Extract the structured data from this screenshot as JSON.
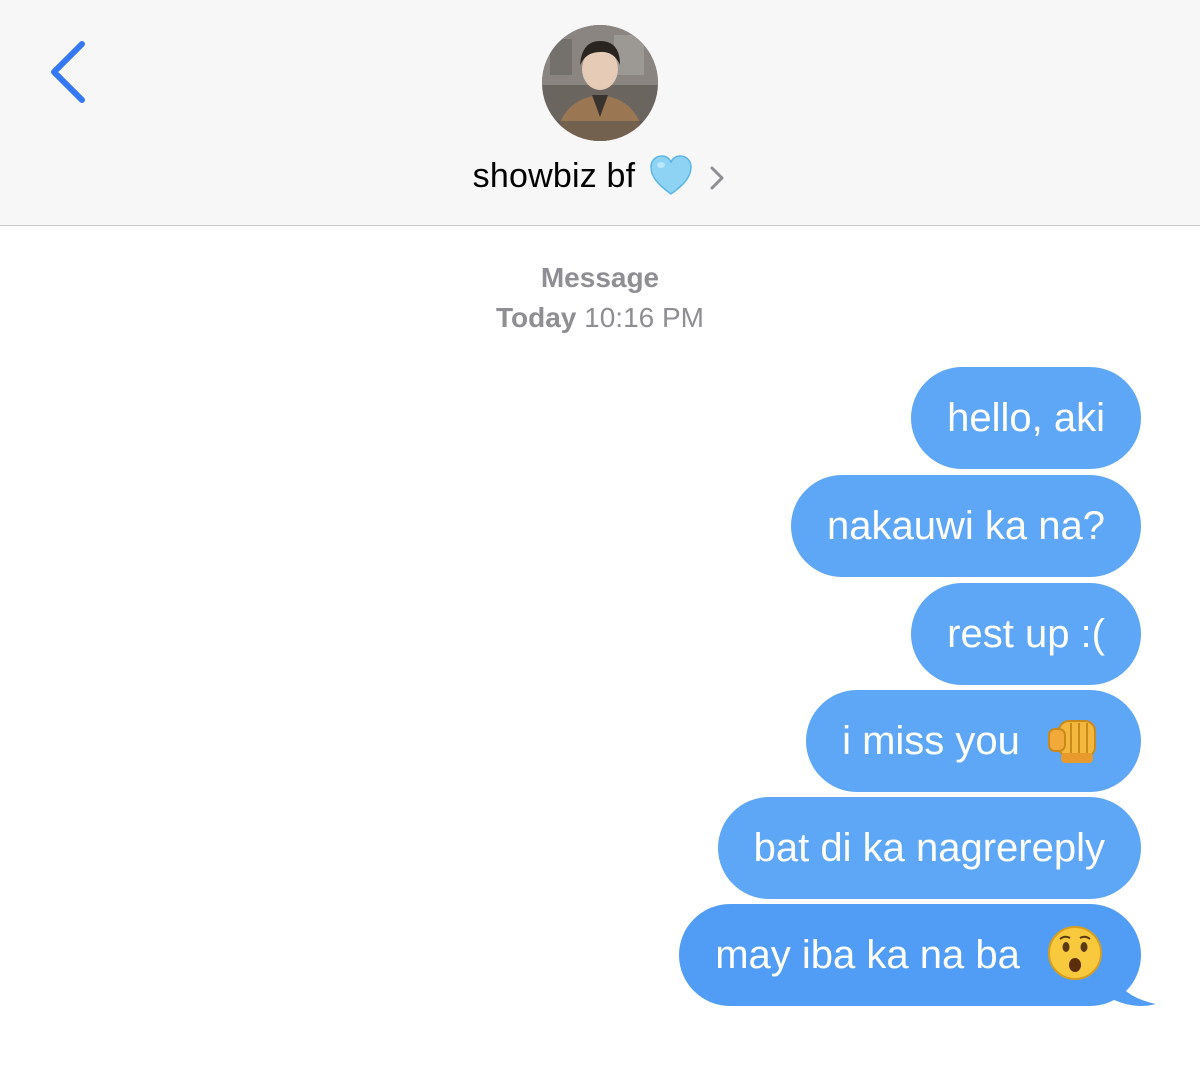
{
  "header": {
    "contact_name": "showbiz bf",
    "heart_icon": "light-blue-heart-icon",
    "chevron_icon": "chevron-right-icon",
    "back_icon": "chevron-left-icon"
  },
  "thread": {
    "service_label": "Message",
    "timestamp_day": "Today",
    "timestamp_time": "10:16 PM"
  },
  "messages": [
    {
      "text": "hello, aki",
      "emoji": null
    },
    {
      "text": "nakauwi ka na?",
      "emoji": null
    },
    {
      "text": "rest up :(",
      "emoji": null
    },
    {
      "text": "i miss you",
      "emoji": "fist-bump-icon"
    },
    {
      "text": "bat di ka nagrereply",
      "emoji": null
    },
    {
      "text": "may iba ka na ba",
      "emoji": "hushed-face-icon"
    }
  ],
  "colors": {
    "header_bg": "#f7f7f7",
    "accent": "#3478f6",
    "bubble": "#5ea6f6",
    "meta_text": "#8e8e93"
  }
}
